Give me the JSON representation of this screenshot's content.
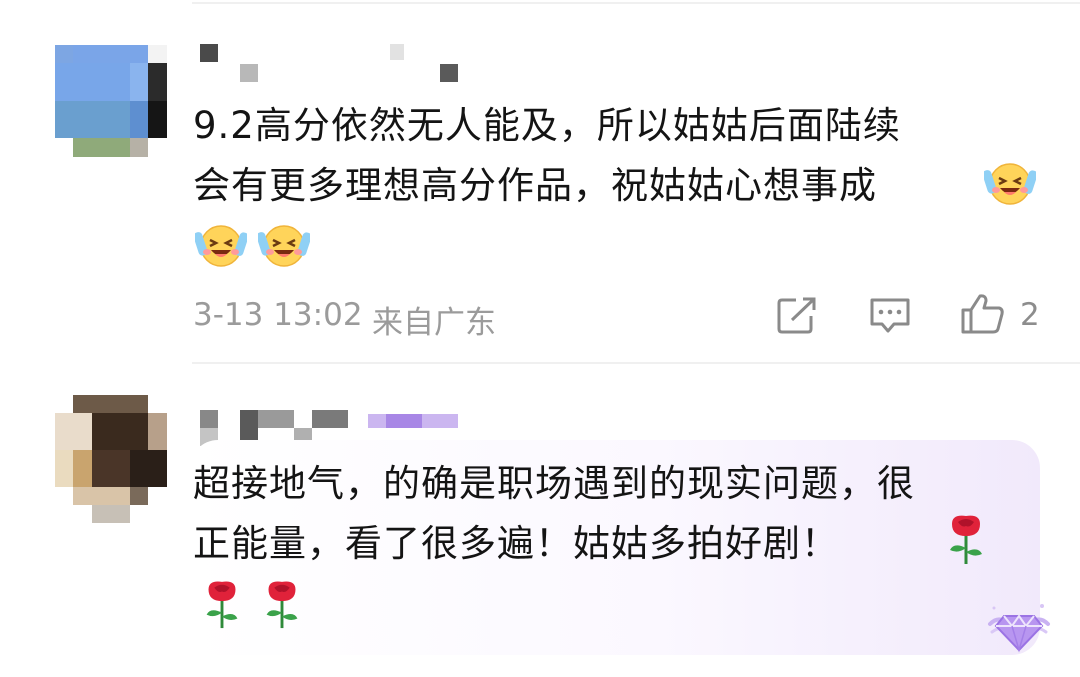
{
  "comments": [
    {
      "text_lines": [
        "9.2高分依然无人能及，所以姑姑后面陆续",
        "会有更多理想高分作品，祝姑姑心想事成"
      ],
      "emojis": [
        "crying-laughing-emoji",
        "crying-laughing-emoji",
        "crying-laughing-emoji"
      ],
      "timestamp": "3-13 13:02",
      "location": "来自广东",
      "like_count": "2",
      "icons": [
        "share-icon",
        "comment-icon",
        "like-icon"
      ]
    },
    {
      "text_lines": [
        "超接地气，的确是职场遇到的现实问题，很",
        "正能量，看了很多遍！姑姑多拍好剧！"
      ],
      "emojis": [
        "rose-emoji",
        "rose-emoji",
        "rose-emoji"
      ],
      "badge_icon": "gem-badge-icon"
    }
  ],
  "colors": {
    "text": "#141414",
    "meta": "#9b9b9b",
    "divider": "#f0f0f0",
    "bubble_tint": "#f1e9fb"
  }
}
